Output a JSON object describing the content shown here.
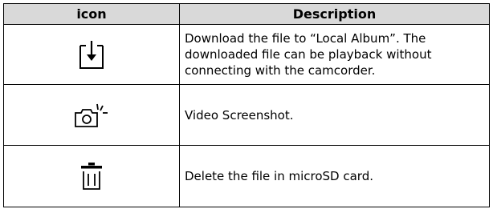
{
  "table": {
    "headers": {
      "icon": "icon",
      "description": "Description"
    },
    "rows": [
      {
        "icon_name": "download-icon",
        "description": "Download the file to “Local Album”. The downloaded file can be playback without connecting with the camcorder."
      },
      {
        "icon_name": "camera-screenshot-icon",
        "description": "Video Screenshot."
      },
      {
        "icon_name": "trash-icon",
        "description": "Delete the file in microSD card."
      }
    ]
  }
}
